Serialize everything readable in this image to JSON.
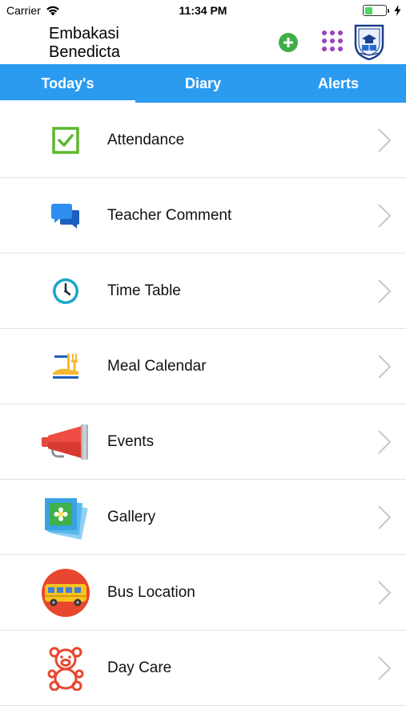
{
  "status_bar": {
    "carrier": "Carrier",
    "time": "11:34 PM"
  },
  "header": {
    "title_line1": "Embakasi",
    "title_line2": "Benedicta"
  },
  "tabs": [
    {
      "label": "Today's",
      "active": true
    },
    {
      "label": "Diary",
      "active": false
    },
    {
      "label": "Alerts",
      "active": false
    }
  ],
  "menu": [
    {
      "label": "Attendance",
      "icon": "checkbox-icon"
    },
    {
      "label": "Teacher Comment",
      "icon": "chat-bubbles-icon"
    },
    {
      "label": "Time Table",
      "icon": "clock-icon"
    },
    {
      "label": "Meal Calendar",
      "icon": "meal-icon"
    },
    {
      "label": "Events",
      "icon": "megaphone-icon"
    },
    {
      "label": "Gallery",
      "icon": "photo-gallery-icon"
    },
    {
      "label": "Bus Location",
      "icon": "school-bus-icon"
    },
    {
      "label": "Day Care",
      "icon": "teddy-bear-icon"
    }
  ],
  "colors": {
    "tab_bar": "#2b9bf0",
    "add_button": "#3fae49",
    "grid_dots": "#9b3fbf",
    "battery_fill": "#4cd964"
  }
}
